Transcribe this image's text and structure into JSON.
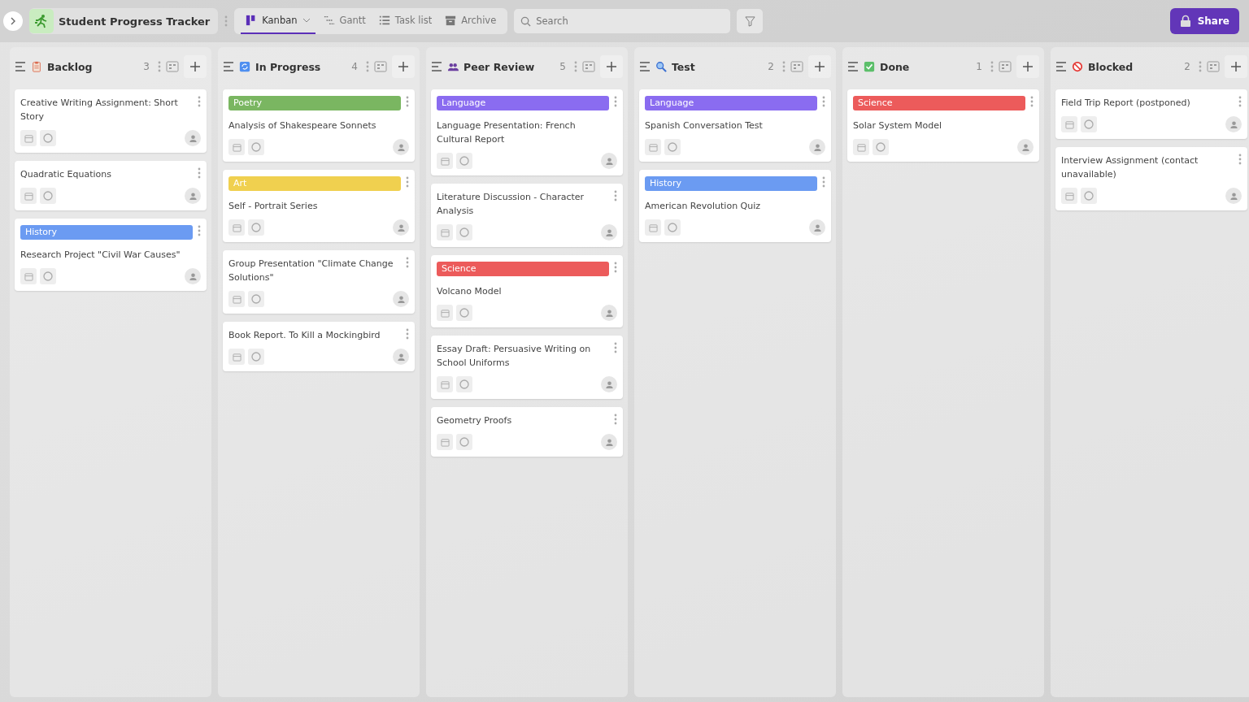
{
  "header": {
    "title": "Student Progress Tracker",
    "search": {
      "placeholder": "Search"
    },
    "share": "Share"
  },
  "tabs": [
    {
      "label": "Kanban",
      "selected": true
    },
    {
      "label": "Gantt",
      "selected": false
    },
    {
      "label": "Task list",
      "selected": false
    },
    {
      "label": "Archive",
      "selected": false
    }
  ],
  "columns": [
    {
      "title": "Backlog",
      "count": "3",
      "cards": [
        {
          "title": "Creative Writing Assignment: Short Story"
        },
        {
          "title": "Quadratic Equations"
        },
        {
          "tag": {
            "label": "History",
            "color": "#6b9bf2"
          },
          "title": "Research Project \"Civil War Causes\""
        }
      ]
    },
    {
      "title": "In Progress",
      "count": "4",
      "cards": [
        {
          "tag": {
            "label": "Poetry",
            "color": "#7ab661"
          },
          "title": "Analysis of Shakespeare Sonnets"
        },
        {
          "tag": {
            "label": "Art",
            "color": "#f0d04f"
          },
          "title": "Self - Portrait Series"
        },
        {
          "title": "Group Presentation \"Climate Change Solutions\""
        },
        {
          "title": "Book Report. To Kill a Mockingbird"
        }
      ]
    },
    {
      "title": "Peer Review",
      "count": "5",
      "cards": [
        {
          "tag": {
            "label": "Language",
            "color": "#8a6cf0"
          },
          "title": "Language Presentation: French Cultural Report"
        },
        {
          "title": "Literature Discussion - Character Analysis"
        },
        {
          "tag": {
            "label": "Science",
            "color": "#ec5b5b"
          },
          "title": "Volcano Model"
        },
        {
          "title": "Essay Draft: Persuasive Writing on School Uniforms"
        },
        {
          "title": "Geometry Proofs"
        }
      ]
    },
    {
      "title": "Test",
      "count": "2",
      "cards": [
        {
          "tag": {
            "label": "Language",
            "color": "#8a6cf0"
          },
          "title": "Spanish Conversation Test"
        },
        {
          "tag": {
            "label": "History",
            "color": "#6b9bf2"
          },
          "title": "American Revolution Quiz"
        }
      ]
    },
    {
      "title": "Done",
      "count": "1",
      "cards": [
        {
          "tag": {
            "label": "Science",
            "color": "#ec5b5b"
          },
          "title": "Solar System Model"
        }
      ]
    },
    {
      "title": "Blocked",
      "count": "2",
      "cards": [
        {
          "title": "Field Trip Report (postponed)"
        },
        {
          "title": "Interview Assignment (contact unavailable)"
        }
      ]
    }
  ]
}
